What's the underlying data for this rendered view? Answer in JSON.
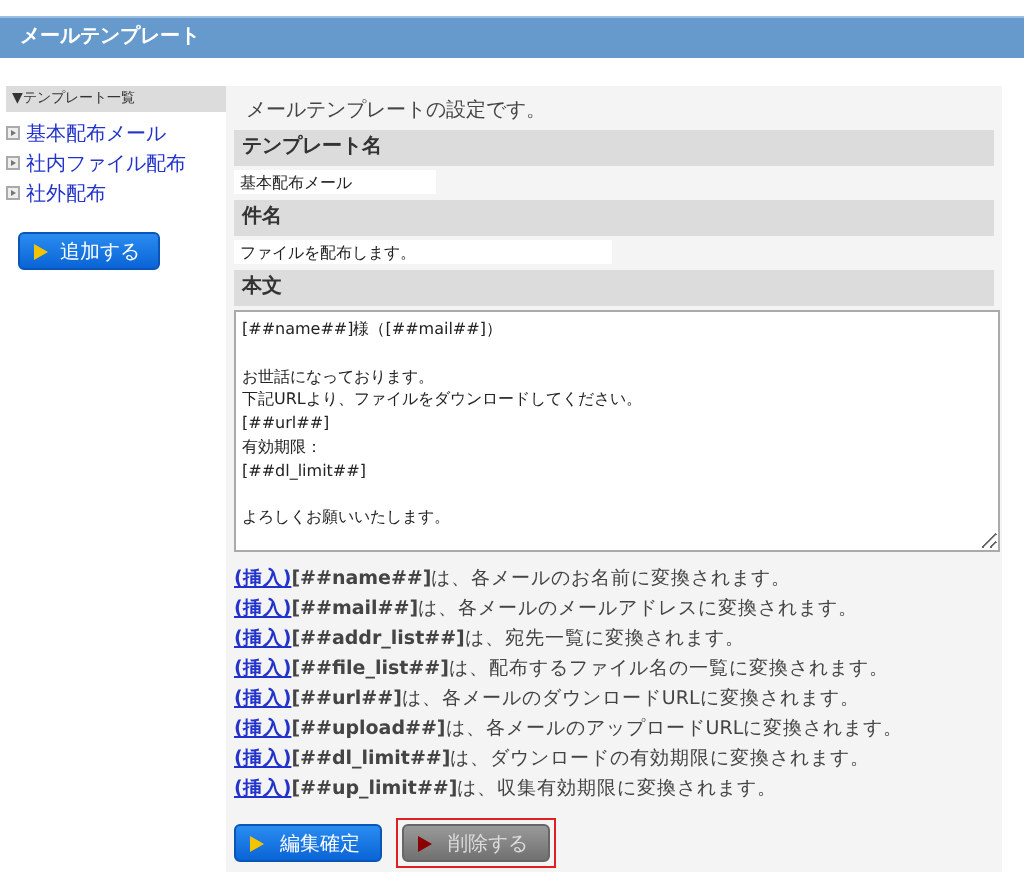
{
  "header": {
    "title": "メールテンプレート"
  },
  "sidebar": {
    "heading": "▼テンプレート一覧",
    "items": [
      {
        "label": "基本配布メール"
      },
      {
        "label": "社内ファイル配布"
      },
      {
        "label": "社外配布"
      }
    ],
    "add_button": "追加する"
  },
  "main": {
    "description": "メールテンプレートの設定です。",
    "fields": [
      {
        "kind": "input",
        "label": "テンプレート名",
        "value": "基本配布メール"
      },
      {
        "kind": "input",
        "label": "件名",
        "value": "ファイルを配布します。"
      },
      {
        "kind": "textarea",
        "label": "本文",
        "paragraphs": [
          [
            "[##name##]様（[##mail##]）"
          ],
          [
            "お世話になっております。",
            "下記URLより、ファイルをダウンロードしてください。",
            "[##url##]",
            "有効期限：",
            "[##dl_limit##]"
          ],
          [
            "よろしくお願いいたします。"
          ]
        ]
      }
    ],
    "hints": [
      {
        "link": "(挿入)",
        "text": "**[##name##]**は、各メールのお名前に変換されます。"
      },
      {
        "link": "(挿入)",
        "text": "**[##mail##]**は、各メールのメールアドレスに変換されます。"
      },
      {
        "link": "(挿入)",
        "text": "**[##addr_list##]**は、宛先一覧に変換されます。"
      },
      {
        "link": "(挿入)",
        "text": "**[##file_list##]**は、配布するファイル名の一覧に変換されます。"
      },
      {
        "link": "(挿入)",
        "text": "**[##url##]**は、各メールのダウンロードURLに変換されます。"
      },
      {
        "link": "(挿入)",
        "text": "**[##upload##]**は、各メールのアップロードURLに変換されます。"
      },
      {
        "link": "(挿入)",
        "text": "**[##dl_limit##]**は、ダウンロードの有効期限に変換されます。"
      },
      {
        "link": "(挿入)",
        "text": "**[##up_limit##]**は、収集有効期限に変換されます。"
      }
    ],
    "buttons": [
      {
        "kind": "primary",
        "label": "編集確定",
        "highlighted": false
      },
      {
        "kind": "danger",
        "label": "削除する",
        "highlighted": true
      }
    ]
  }
}
